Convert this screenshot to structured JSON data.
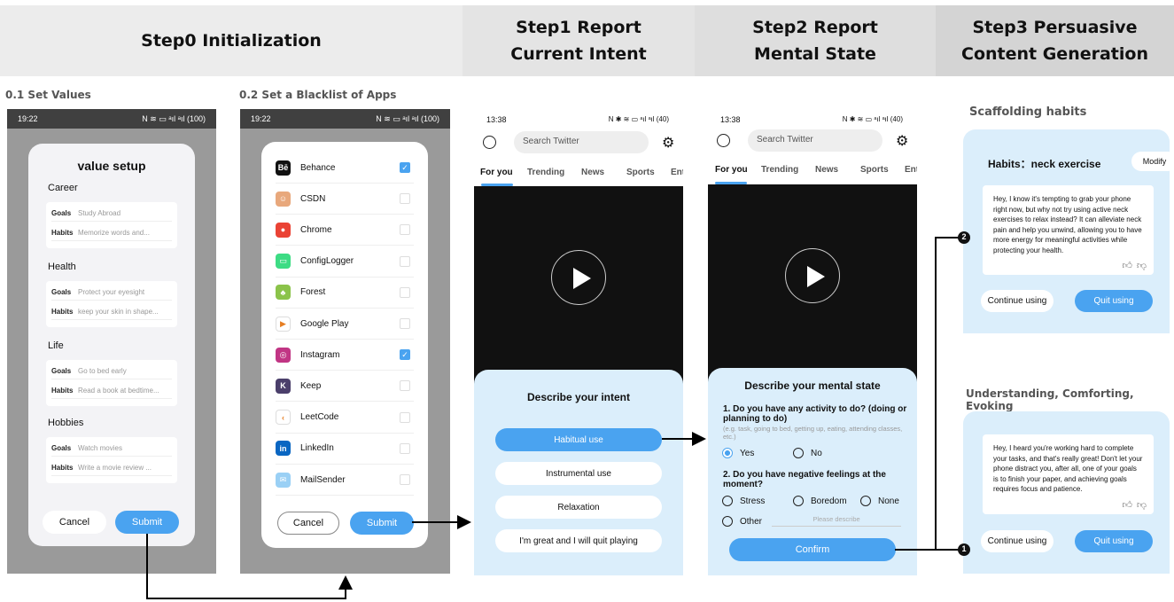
{
  "headers": {
    "step0": "Step0   Initialization",
    "step1": "Step1   Report\nCurrent Intent",
    "step2": "Step2   Report\nMental State",
    "step3": "Step3   Persuasive\nContent Generation"
  },
  "subheaders": {
    "set_values": "0.1 Set Values",
    "set_blacklist": "0.2 Set a Blacklist of Apps",
    "scaffolding": "Scaffolding habits",
    "understanding": "Understanding, Comforting, Evoking"
  },
  "colors": {
    "header_bg": "#ececec",
    "accent": "#4aa3f0",
    "sheet_bg": "#dbeefb",
    "status_bg": "#404040"
  },
  "values_screen": {
    "time": "19:22",
    "status_icons": "N ≋ ▭ ᵃıl ᵃıl (100)",
    "title": "value setup",
    "sections": [
      {
        "name": "Career",
        "goals_label": "Goals",
        "goals": "Study Abroad",
        "habits_label": "Habits",
        "habits": "Memorize words and..."
      },
      {
        "name": "Health",
        "goals_label": "Goals",
        "goals": "Protect your eyesight",
        "habits_label": "Habits",
        "habits": "keep your skin in shape..."
      },
      {
        "name": "Life",
        "goals_label": "Goals",
        "goals": "Go to bed early",
        "habits_label": "Habits",
        "habits": "Read a book at bedtime..."
      },
      {
        "name": "Hobbies",
        "goals_label": "Goals",
        "goals": "Watch movies",
        "habits_label": "Habits",
        "habits": "Write a movie review ..."
      }
    ],
    "cancel": "Cancel",
    "submit": "Submit"
  },
  "blacklist_screen": {
    "time": "19:22",
    "status_icons": "N ≋ ▭ ᵃıl ᵃıl (100)",
    "apps": [
      {
        "name": "Behance",
        "icon": "Bē",
        "color": "#111111",
        "checked": true
      },
      {
        "name": "CSDN",
        "icon": "☺",
        "color": "#e8a87c",
        "checked": false
      },
      {
        "name": "Chrome",
        "icon": "●",
        "color": "#ea4335",
        "checked": false
      },
      {
        "name": "ConfigLogger",
        "icon": "▭",
        "color": "#3ddc84",
        "checked": false
      },
      {
        "name": "Forest",
        "icon": "♣",
        "color": "#8bc34a",
        "checked": false
      },
      {
        "name": "Google Play",
        "icon": "▶",
        "color": "#ffffff",
        "checked": false
      },
      {
        "name": "Instagram",
        "icon": "◎",
        "color": "#c13584",
        "checked": true
      },
      {
        "name": "Keep",
        "icon": "K",
        "color": "#4b3f6b",
        "checked": false
      },
      {
        "name": "LeetCode",
        "icon": "‹",
        "color": "#ffffff",
        "checked": false
      },
      {
        "name": "LinkedIn",
        "icon": "in",
        "color": "#0a66c2",
        "checked": false
      },
      {
        "name": "MailSender",
        "icon": "✉",
        "color": "#9ad0f5",
        "checked": false
      }
    ],
    "cancel": "Cancel",
    "submit": "Submit"
  },
  "intent_screen": {
    "time": "13:38",
    "status_icons": "N ✱ ≋ ▭ ᵃıl ᵃıl (40)",
    "search_placeholder": "Search Twitter",
    "tabs": [
      "For you",
      "Trending",
      "News",
      "Sports",
      "Ent"
    ],
    "sheet_title": "Describe your intent",
    "options": [
      "Habitual use",
      "Instrumental use",
      "Relaxation",
      "I'm great and I will quit playing"
    ],
    "selected_index": 0
  },
  "mental_screen": {
    "time": "13:38",
    "status_icons": "N ✱ ≋ ▭ ᵃıl ᵃıl (40)",
    "search_placeholder": "Search Twitter",
    "tabs": [
      "For you",
      "Trending",
      "News",
      "Sports",
      "Ent"
    ],
    "sheet_title": "Describe your mental state",
    "q1": "1. Do you have any activity to do? (doing or planning to do)",
    "q1_hint": "(e.g. task, going to bed, getting up, eating, attending classes, etc.)",
    "q1_yes": "Yes",
    "q1_no": "No",
    "q2": "2. Do you have negative feelings at the moment?",
    "q2_opts": [
      "Stress",
      "Boredom",
      "None",
      "Other"
    ],
    "other_placeholder": "Please describe",
    "confirm": "Confirm"
  },
  "scaffold_card": {
    "title": "Habits：neck exercise",
    "modify": "Modify",
    "message": "Hey, I know it's tempting to grab your phone right now, but why not try using active neck exercises to relax instead? It can alleviate neck pain and help you unwind, allowing you to have more energy for meaningful activities while protecting your health.",
    "continue": "Continue using",
    "quit": "Quit using",
    "marker": "2"
  },
  "understand_card": {
    "message": "Hey, I heard you're working hard to complete your tasks, and that's really great! Don't let your phone distract you, after all, one of your goals is to finish your paper, and achieving goals requires focus and patience.",
    "continue": "Continue using",
    "quit": "Quit using",
    "marker": "1"
  }
}
